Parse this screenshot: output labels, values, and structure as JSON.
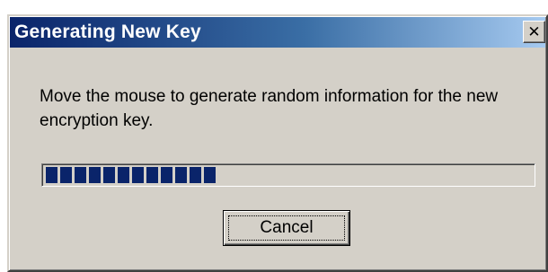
{
  "window": {
    "title": "Generating New Key",
    "close_label": "✕",
    "close_icon": "close-icon"
  },
  "content": {
    "message": "Move the mouse to generate random information for the new encryption key.",
    "progress": 0.35
  },
  "buttons": {
    "cancel_label": "Cancel"
  },
  "colors": {
    "titlebar_start": "#0a246a",
    "titlebar_end": "#a6caf0",
    "dialog_face": "#d4d0c8",
    "progress_block": "#0a246a"
  }
}
